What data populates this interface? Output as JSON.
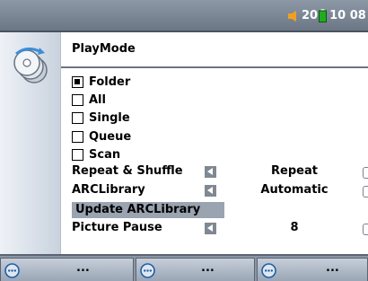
{
  "status": {
    "volume": "20",
    "time": "10 08"
  },
  "panel": {
    "title": "PlayMode"
  },
  "play_modes": [
    {
      "label": "Folder",
      "checked": true
    },
    {
      "label": "All",
      "checked": false
    },
    {
      "label": "Single",
      "checked": false
    },
    {
      "label": "Queue",
      "checked": false
    },
    {
      "label": "Scan",
      "checked": false
    }
  ],
  "settings": {
    "repeat_shuffle": {
      "label": "Repeat & Shuffle",
      "value": "Repeat"
    },
    "arclibrary": {
      "label": "ARCLibrary",
      "value": "Automatic"
    },
    "update_label": "Update ARCLibrary",
    "picture_pause": {
      "label": "Picture Pause",
      "value": "8"
    }
  },
  "softkeys": [
    {
      "label": "...",
      "icon": "menu-dots-icon"
    },
    {
      "label": "...",
      "icon": "menu-dots-icon"
    },
    {
      "label": "...",
      "icon": "menu-dots-icon"
    }
  ],
  "colors": {
    "statusbar": "#7b8697",
    "highlight": "#9aa3b0",
    "battery": "#22aa22",
    "speaker": "#f0a020"
  }
}
